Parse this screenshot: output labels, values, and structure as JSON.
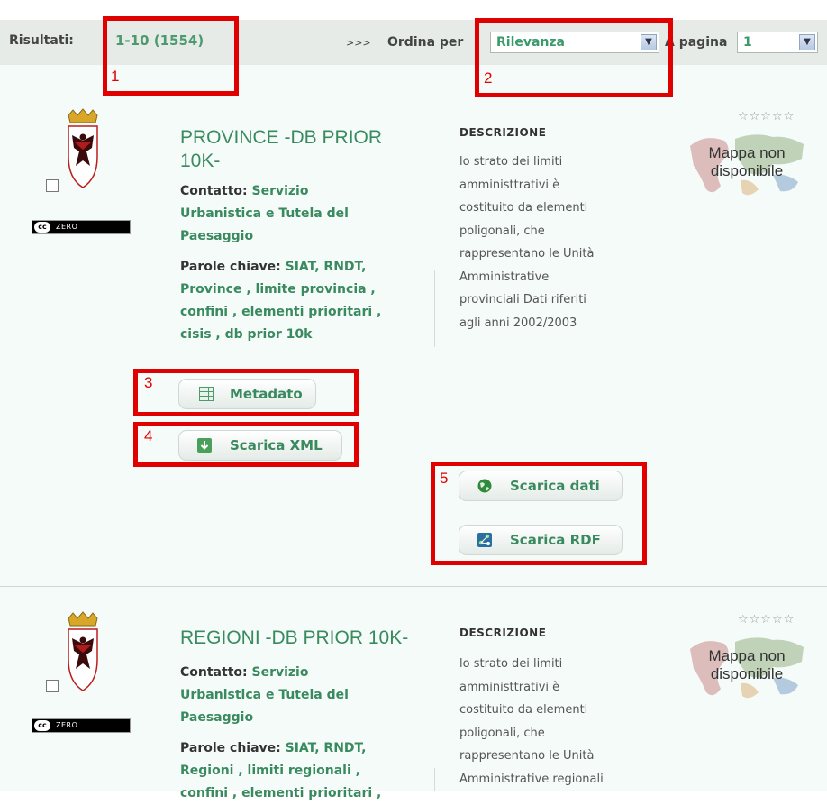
{
  "toolbar": {
    "results_label": "Risultati:",
    "results_value": "1-10 (1554)",
    "order_prefix": ">>>",
    "order_label": "Ordina per",
    "order_value": "Rilevanza",
    "perpage_label": "A pagina",
    "perpage_value": "1"
  },
  "markers": [
    "1",
    "2",
    "3",
    "4",
    "5"
  ],
  "results": [
    {
      "title_line1": "PROVINCE -DB PRIOR",
      "title_line2": "10K-",
      "contact_label": "Contatto:",
      "contact_l1": "Servizio",
      "contact_l2": "Urbanistica e Tutela del",
      "contact_l3": "Paesaggio",
      "keywords_label": "Parole chiave:",
      "kw_l1": "SIAT, RNDT,",
      "kw_l2": "Province , limite provincia ,",
      "kw_l3": "confini , elementi prioritari ,",
      "kw_l4": "cisis , db prior 10k",
      "desc_heading": "DESCRIZIONE",
      "desc_lines": [
        "lo strato dei limiti",
        "amministtrativi è",
        "costituito da elementi",
        "poligonali, che",
        "rappresentano le Unità",
        "Amministrative",
        "provinciali Dati riferiti",
        "agli anni 2002/2003"
      ],
      "map_text_l1": "Mappa non",
      "map_text_l2": "disponibile",
      "stars": "☆☆☆☆☆",
      "license": "ZERO",
      "cc_mark": "cc"
    },
    {
      "title_line1": "REGIONI -DB PRIOR 10K-",
      "contact_label": "Contatto:",
      "contact_l1": "Servizio",
      "contact_l2": "Urbanistica e Tutela del",
      "contact_l3": "Paesaggio",
      "keywords_label": "Parole chiave:",
      "kw_l1": "SIAT, RNDT,",
      "kw_l2": "Regioni , limiti regionali ,",
      "kw_l3": "confini , elementi prioritari ,",
      "desc_heading": "DESCRIZIONE",
      "desc_lines": [
        "lo strato dei limiti",
        "amministtrativi è",
        "costituito da elementi",
        "poligonali, che",
        "rappresentano le Unità",
        "Amministrative regionali"
      ],
      "map_text_l1": "Mappa non",
      "map_text_l2": "disponibile",
      "stars": "☆☆☆☆☆",
      "license": "ZERO",
      "cc_mark": "cc"
    }
  ],
  "buttons": {
    "metadata": "Metadato",
    "xml": "Scarica XML",
    "data": "Scarica dati",
    "rdf": "Scarica RDF"
  },
  "colors": {
    "accent_green": "#3a8a60",
    "highlight_red": "#e00000",
    "panel_bg": "#f4fbf8",
    "toolbar_bg": "#e6ebe8"
  }
}
